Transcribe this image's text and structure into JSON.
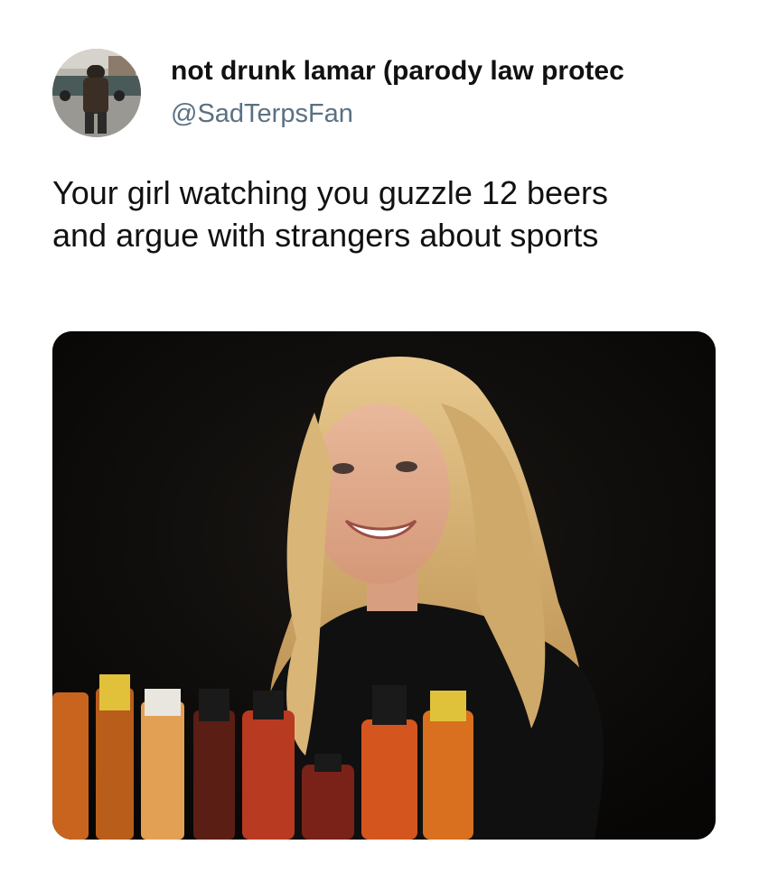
{
  "tweet": {
    "display_name": "not drunk lamar (parody law protec",
    "handle": "@SadTerpsFan",
    "text_lines": [
      "Your girl watching you guzzle 12 beers",
      "and argue with strangers about sports"
    ]
  },
  "colors": {
    "name": "#111111",
    "handle": "#5b7083",
    "background": "#ffffff"
  }
}
